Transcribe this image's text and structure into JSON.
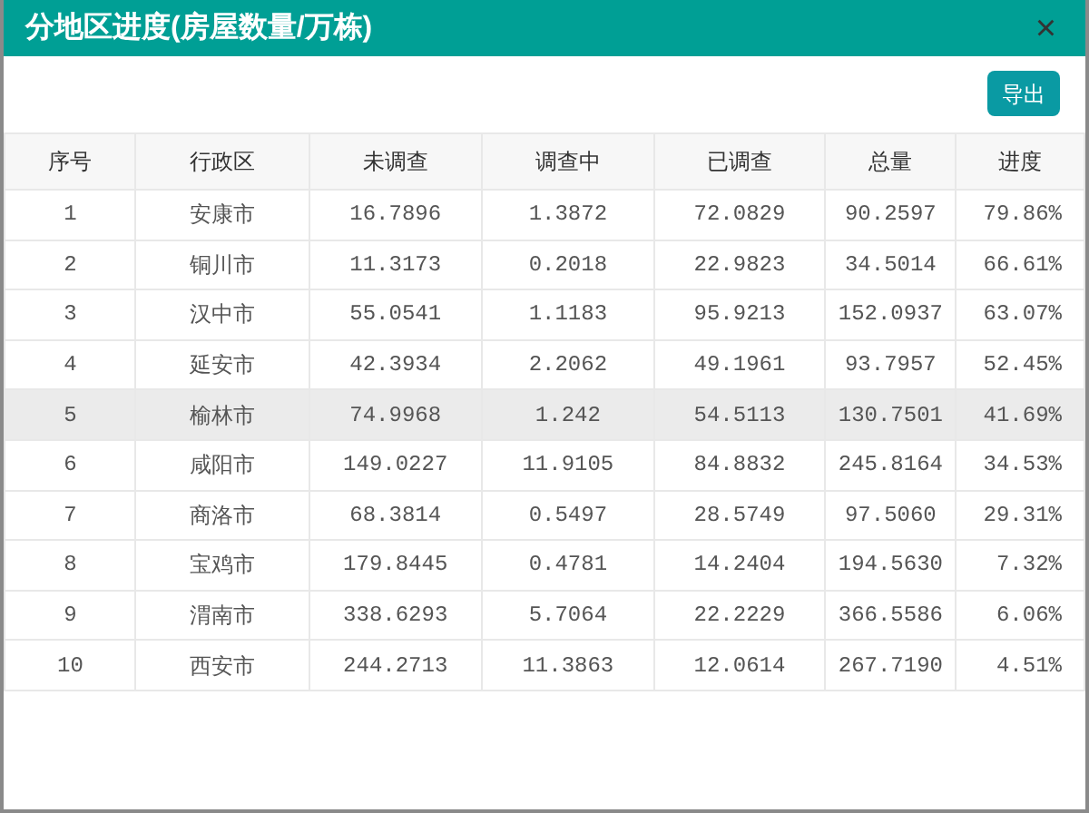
{
  "dialog": {
    "title": "分地区进度(房屋数量/万栋)",
    "close": "×"
  },
  "toolbar": {
    "export_button": "导出"
  },
  "table": {
    "columns": [
      "序号",
      "行政区",
      "未调查",
      "调查中",
      "已调查",
      "总量",
      "进度"
    ],
    "rows": [
      {
        "cells": [
          "1",
          "安康市",
          "16.7896",
          "1.3872",
          "72.0829",
          "90.2597",
          "79.86%"
        ],
        "selected": false
      },
      {
        "cells": [
          "2",
          "铜川市",
          "11.3173",
          "0.2018",
          "22.9823",
          "34.5014",
          "66.61%"
        ],
        "selected": false
      },
      {
        "cells": [
          "3",
          "汉中市",
          "55.0541",
          "1.1183",
          "95.9213",
          "152.0937",
          "63.07%"
        ],
        "selected": false
      },
      {
        "cells": [
          "4",
          "延安市",
          "42.3934",
          "2.2062",
          "49.1961",
          "93.7957",
          "52.45%"
        ],
        "selected": false
      },
      {
        "cells": [
          "5",
          "榆林市",
          "74.9968",
          "1.242",
          "54.5113",
          "130.7501",
          "41.69%"
        ],
        "selected": true
      },
      {
        "cells": [
          "6",
          "咸阳市",
          "149.0227",
          "11.9105",
          "84.8832",
          "245.8164",
          "34.53%"
        ],
        "selected": false
      },
      {
        "cells": [
          "7",
          "商洛市",
          "68.3814",
          "0.5497",
          "28.5749",
          "97.5060",
          "29.31%"
        ],
        "selected": false
      },
      {
        "cells": [
          "8",
          "宝鸡市",
          "179.8445",
          "0.4781",
          "14.2404",
          "194.5630",
          "7.32%"
        ],
        "selected": false
      },
      {
        "cells": [
          "9",
          "渭南市",
          "338.6293",
          "5.7064",
          "22.2229",
          "366.5586",
          "6.06%"
        ],
        "selected": false
      },
      {
        "cells": [
          "10",
          "西安市",
          "244.2713",
          "11.3863",
          "12.0614",
          "267.7190",
          "4.51%"
        ],
        "selected": false
      }
    ]
  }
}
